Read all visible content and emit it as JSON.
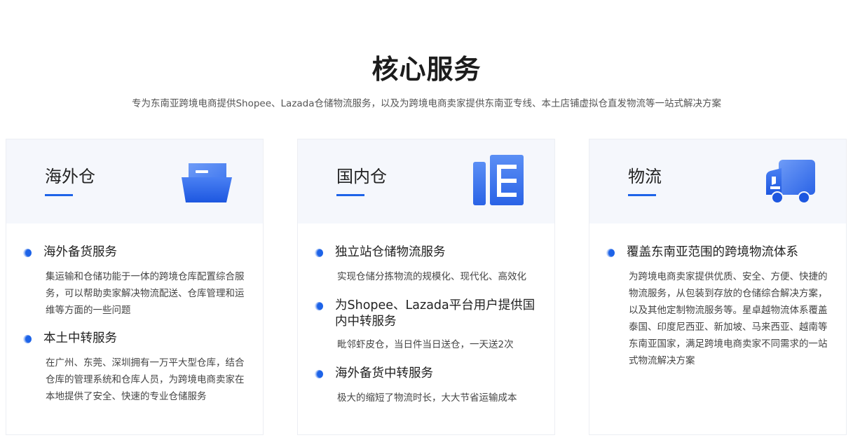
{
  "section": {
    "title": "核心服务",
    "subtitle": "专为东南亚跨境电商提供Shopee、Lazada仓储物流服务，以及为跨境电商卖家提供东南亚专线、本土店铺虚拟仓直发物流等一站式解决方案"
  },
  "colors": {
    "accent": "#1d63e8",
    "card_header_bg": "#f5f7fc",
    "icon_light": "#5b8ff5"
  },
  "cards": [
    {
      "title": "海外仓",
      "icon": "folder-icon",
      "items": [
        {
          "title": "海外备货服务",
          "desc": "集运输和仓储功能于一体的跨境仓库配置综合服务，可以帮助卖家解决物流配送、仓库管理和运维等方面的一些问题"
        },
        {
          "title": "本土中转服务",
          "desc": "在广州、东莞、深圳拥有一万平大型仓库，结合仓库的管理系统和仓库人员，为跨境电商卖家在本地提供了安全、快速的专业仓储服务"
        }
      ]
    },
    {
      "title": "国内仓",
      "icon": "warehouse-shelf-icon",
      "items": [
        {
          "title": "独立站仓储物流服务",
          "desc": "实现仓储分拣物流的规模化、现代化、高效化"
        },
        {
          "title": "为Shopee、Lazada平台用户提供国内中转服务",
          "desc": "毗邻虾皮仓，当日件当日送仓，一天送2次"
        },
        {
          "title": "海外备货中转服务",
          "desc": "极大的缩短了物流时长，大大节省运输成本"
        }
      ]
    },
    {
      "title": "物流",
      "icon": "delivery-truck-icon",
      "items": [
        {
          "title": "覆盖东南亚范围的跨境物流体系",
          "desc": "为跨境电商卖家提供优质、安全、方便、快捷的物流服务，从包装到存放的仓储综合解决方案，以及其他定制物流服务等。星卓越物流体系覆盖泰国、印度尼西亚、新加坡、马来西亚、越南等东南亚国家，满足跨境电商卖家不同需求的一站式物流解决方案"
        }
      ]
    }
  ]
}
